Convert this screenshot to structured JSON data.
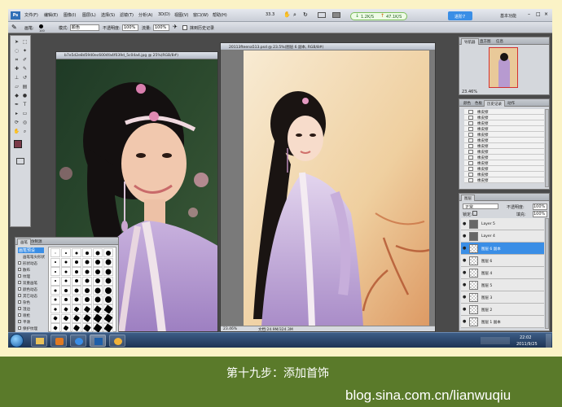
{
  "menu": {
    "items": [
      "文件(F)",
      "编辑(E)",
      "图像(I)",
      "图层(L)",
      "选择(S)",
      "滤镜(T)",
      "分析(A)",
      "3D(D)",
      "视图(V)",
      "窗口(W)",
      "帮助(H)"
    ],
    "zoom": "33.3",
    "workspace": "基本功能",
    "speed_down": "1.2K/S",
    "speed_up": "47.1K/S",
    "badge": "进阶7"
  },
  "options": {
    "brush_label": "画笔:",
    "brush_size": "100",
    "mode_label": "模式:",
    "mode_value": "颜色",
    "opacity_label": "不透明度:",
    "opacity_value": "100%",
    "flow_label": "流量:",
    "flow_value": "100%",
    "history_label": "抹到历史记录"
  },
  "documents": [
    {
      "title": "b7e5d2e8d5940ec6004fa4f039d_5c04a4.jpg @ 25%(RGB/8#)",
      "zoom": "",
      "doc_size": ""
    },
    {
      "title": "20113fteena513.psd @ 23.5%(图层 6 副本, RGB/8#)",
      "zoom": "23.46%",
      "doc_size": "文档:24.9M/324.3M"
    }
  ],
  "navigator": {
    "tabs": [
      "导航器",
      "直方图",
      "信息"
    ],
    "zoom": "23.46%"
  },
  "history": {
    "tabs": [
      "颜色",
      "色板",
      "历史记录",
      "动作"
    ],
    "items": [
      "橡皮擦",
      "橡皮擦",
      "橡皮擦",
      "橡皮擦",
      "橡皮擦",
      "橡皮擦",
      "橡皮擦",
      "橡皮擦",
      "橡皮擦",
      "橡皮擦",
      "橡皮擦",
      "橡皮擦",
      "橡皮擦"
    ]
  },
  "layers": {
    "tabs": [
      "图层"
    ],
    "blend_mode": "正常",
    "opacity_label": "不透明度:",
    "opacity": "100%",
    "lock_label": "锁定:",
    "fill_label": "填充:",
    "fill": "100%",
    "items": [
      {
        "name": "Layer 5",
        "selected": false,
        "solid": true
      },
      {
        "name": "Layer 4",
        "selected": false,
        "solid": true
      },
      {
        "name": "图层 6 副本",
        "selected": true,
        "solid": false
      },
      {
        "name": "图层 6",
        "selected": false,
        "solid": false
      },
      {
        "name": "图层 4",
        "selected": false,
        "solid": false
      },
      {
        "name": "图层 5",
        "selected": false,
        "solid": false
      },
      {
        "name": "图层 3",
        "selected": false,
        "solid": false
      },
      {
        "name": "图层 2",
        "selected": false,
        "solid": false
      },
      {
        "name": "图层 1 副本",
        "selected": false,
        "solid": false
      }
    ]
  },
  "brushes": {
    "tabs": [
      "画笔",
      "仿制源"
    ],
    "presets_label": "画笔预设",
    "options": [
      "画笔笔尖形状",
      "形状动态",
      "散布",
      "纹理",
      "双重画笔",
      "颜色动态",
      "其它动态",
      "杂色",
      "湿边",
      "喷枪",
      "平滑",
      "保护纹理"
    ]
  },
  "taskbar": {
    "time": "22:02",
    "date": "2011/9/25"
  },
  "caption": {
    "step": "第十九步：添加首饰",
    "site": "blog.sina.com.cn/lianwuqiu"
  }
}
